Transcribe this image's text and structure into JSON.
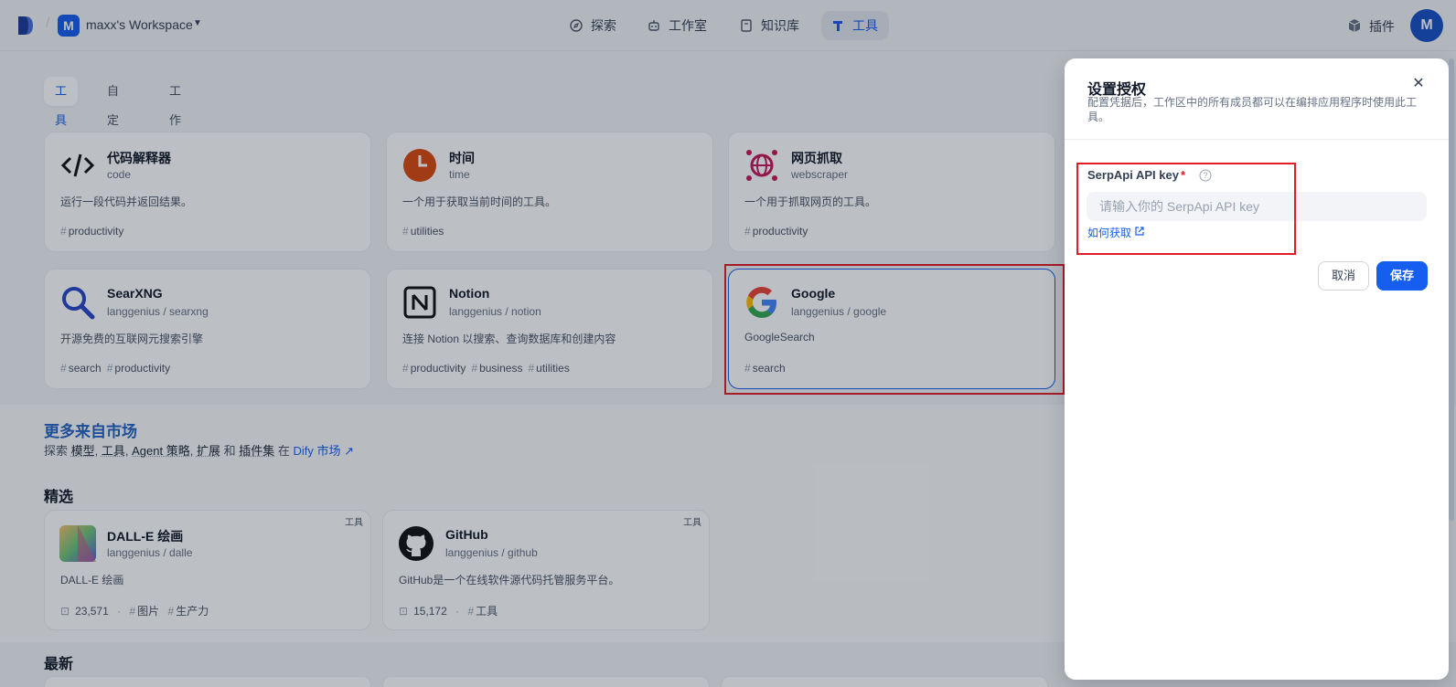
{
  "topbar": {
    "workspace_initial": "M",
    "workspace_name": "maxx's Workspace",
    "nav": [
      {
        "label": "探索",
        "icon": "compass-icon"
      },
      {
        "label": "工作室",
        "icon": "robot-icon"
      },
      {
        "label": "知识库",
        "icon": "book-icon"
      },
      {
        "label": "工具",
        "icon": "tools-icon",
        "active": true
      }
    ],
    "plugins_label": "插件",
    "user_initial": "M"
  },
  "tabs": [
    "工具",
    "自定义",
    "工作流"
  ],
  "tools": [
    {
      "title": "代码解释器",
      "sub": "code",
      "desc": "运行一段代码并返回结果。",
      "tags": [
        "productivity"
      ],
      "icon": "code-icon"
    },
    {
      "title": "时间",
      "sub": "time",
      "desc": "一个用于获取当前时间的工具。",
      "tags": [
        "utilities"
      ],
      "icon": "clock-icon"
    },
    {
      "title": "网页抓取",
      "sub": "webscraper",
      "desc": "一个用于抓取网页的工具。",
      "tags": [
        "productivity"
      ],
      "icon": "globe-spider-icon"
    },
    {
      "title": "SearXNG",
      "sub": "langgenius / searxng",
      "desc": "开源免费的互联网元搜索引擎",
      "tags": [
        "search",
        "productivity"
      ],
      "icon": "magnifier-icon"
    },
    {
      "title": "Notion",
      "sub": "langgenius / notion",
      "desc": "连接 Notion 以搜索、查询数据库和创建内容",
      "tags": [
        "productivity",
        "business",
        "utilities"
      ],
      "icon": "notion-icon"
    },
    {
      "title": "Google",
      "sub": "langgenius / google",
      "desc": "GoogleSearch",
      "tags": [
        "search"
      ],
      "icon": "google-icon"
    }
  ],
  "marketplace": {
    "title": "更多来自市场",
    "sub_prefix": "探索",
    "sub_items": [
      "模型",
      "工具",
      "Agent 策略",
      "扩展"
    ],
    "sub_and": "和",
    "sub_last": "插件集",
    "sub_in": "在",
    "link": "Dify 市场 ↗",
    "featured_heading": "精选",
    "latest_heading": "最新",
    "featured": [
      {
        "title": "DALL-E 绘画",
        "sub": "langgenius / dalle",
        "desc": "DALL-E 绘画",
        "downloads": "23,571",
        "tags": [
          "图片",
          "生产力"
        ],
        "badge": "工具",
        "icon": "dalle-icon"
      },
      {
        "title": "GitHub",
        "sub": "langgenius / github",
        "desc": "GitHub是一个在线软件源代码托管服务平台。",
        "downloads": "15,172",
        "tags": [
          "工具"
        ],
        "badge": "工具",
        "icon": "github-icon"
      }
    ]
  },
  "drawer": {
    "title": "设置授权",
    "desc": "配置凭据后，工作区中的所有成员都可以在编排应用程序时使用此工具。",
    "field_label": "SerpApi API key",
    "required_mark": "*",
    "placeholder": "请输入你的 SerpApi API key",
    "value": "",
    "how_to_get": "如何获取",
    "cancel": "取消",
    "save": "保存"
  },
  "colors": {
    "accent": "#155eef",
    "highlight_box": "#e11d26"
  }
}
